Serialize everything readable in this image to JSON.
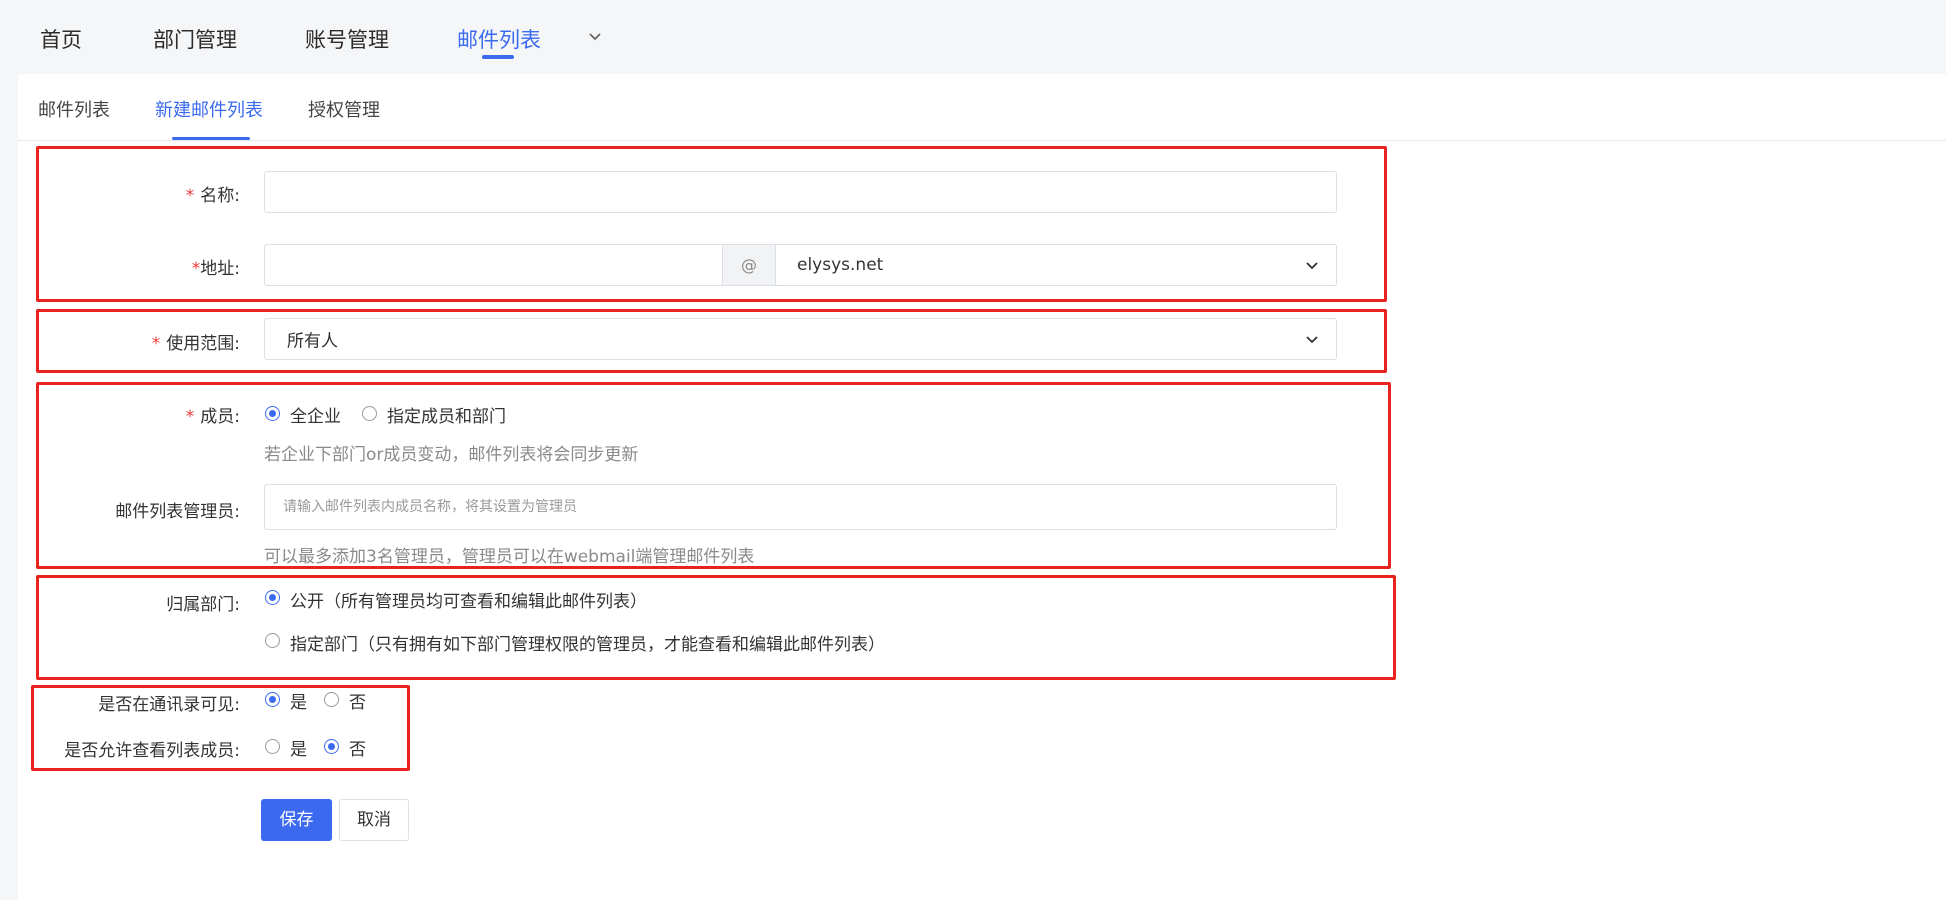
{
  "nav": {
    "items": [
      {
        "label": "首页"
      },
      {
        "label": "部门管理"
      },
      {
        "label": "账号管理"
      },
      {
        "label": "邮件列表"
      }
    ],
    "active_color": "#3b6af0"
  },
  "subtabs": [
    {
      "label": "邮件列表"
    },
    {
      "label": "新建邮件列表"
    },
    {
      "label": "授权管理"
    }
  ],
  "form": {
    "name": {
      "label": "名称:",
      "value": ""
    },
    "address": {
      "label": "地址:",
      "value": "",
      "at_symbol": "@",
      "domain": "elysys.net"
    },
    "scope": {
      "label": "使用范围:",
      "value": "所有人"
    },
    "members": {
      "label": "成员:",
      "options": [
        "全企业",
        "指定成员和部门"
      ],
      "selected": "全企业",
      "hint": "若企业下部门or成员变动，邮件列表将会同步更新"
    },
    "admins": {
      "label": "邮件列表管理员:",
      "placeholder": "请输入邮件列表内成员名称，将其设置为管理员",
      "hint": "可以最多添加3名管理员，管理员可以在webmail端管理邮件列表"
    },
    "department": {
      "label": "归属部门:",
      "options": [
        "公开（所有管理员均可查看和编辑此邮件列表）",
        "指定部门（只有拥有如下部门管理权限的管理员，才能查看和编辑此邮件列表）"
      ],
      "selected": "公开（所有管理员均可查看和编辑此邮件列表）"
    },
    "visible_in_contacts": {
      "label": "是否在通讯录可见:",
      "options": [
        "是",
        "否"
      ],
      "selected": "是"
    },
    "allow_view_members": {
      "label": "是否允许查看列表成员:",
      "options": [
        "是",
        "否"
      ],
      "selected": "否"
    }
  },
  "buttons": {
    "save": "保存",
    "cancel": "取消"
  },
  "colors": {
    "accent": "#3b6af0",
    "required": "#ef3b3b",
    "annotation": "#e8231f"
  }
}
